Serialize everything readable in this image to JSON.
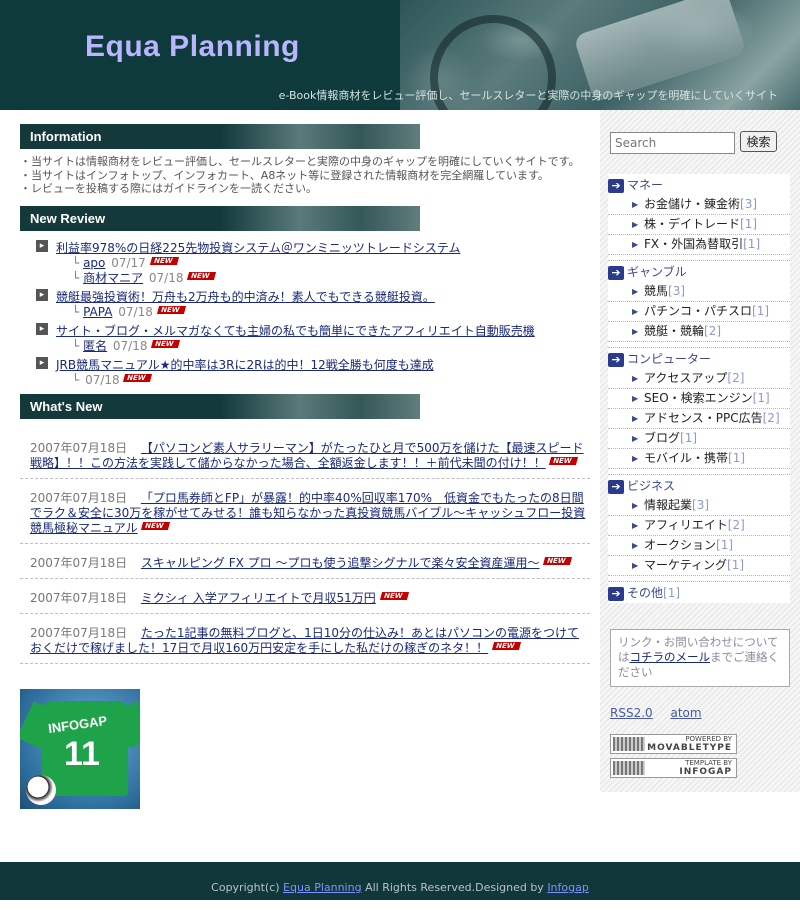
{
  "header": {
    "title": "Equa Planning",
    "tagline": "e-Book情報商材をレビュー評価し、セールスレターと実際の中身のギャップを明確にしていくサイト"
  },
  "information": {
    "heading": "Information",
    "items": [
      "当サイトは情報商材をレビュー評価し、セールスレターと実際の中身のギャップを明確にしていくサイトです。",
      "当サイトはインフォトップ、インフォカート、A8ネット等に登録された情報商材を完全網羅しています。",
      "レビューを投稿する際にはガイドラインを一読ください。"
    ]
  },
  "new_review": {
    "heading": "New Review",
    "new_label": "NEW",
    "corner": "└",
    "items": [
      {
        "title": "利益率978%の日経225先物投資システム＠ワンミニッツトレードシステム",
        "replies": [
          {
            "author": "apo",
            "date": "07/17"
          },
          {
            "author": "商材マニア",
            "date": "07/18"
          }
        ]
      },
      {
        "title": "競艇最強投資術！万舟も2万舟も的中済み！素人でもできる競艇投資。",
        "replies": [
          {
            "author": "PAPA",
            "date": "07/18"
          }
        ]
      },
      {
        "title": "サイト・ブログ・メルマガなくても主婦の私でも簡単にできたアフィリエイト自動販売機",
        "replies": [
          {
            "author": "匿名",
            "date": "07/18"
          }
        ]
      },
      {
        "title": "JRB競馬マニュアル★的中率は3Rに2Rは的中！12戦全勝も何度も達成",
        "replies": [
          {
            "author": "",
            "date": "07/18"
          }
        ]
      }
    ]
  },
  "whats_new": {
    "heading": "What's New",
    "items": [
      {
        "date": "2007年07月18日",
        "title": "【パソコンど素人サラリーマン】がたったひと月で500万を儲けた【最速スピード戦略】！！この方法を実践して儲からなかった場合、全額返金します！！＋前代未聞の付け！！"
      },
      {
        "date": "2007年07月18日",
        "title": "「プロ馬券師とFP」が暴露！的中率40%回収率170%　低資金でもたったの8日間でラク＆安全に30万を稼がせてみせる！誰も知らなかった真投資競馬バイブル〜キャッシュフロー投資競馬極秘マニュアル"
      },
      {
        "date": "2007年07月18日",
        "title": "スキャルピング FX プロ 〜プロも使う追撃シグナルで楽々安全資産運用〜"
      },
      {
        "date": "2007年07月18日",
        "title": "ミクシィ 入学アフィリエイトで月収51万円"
      },
      {
        "date": "2007年07月18日",
        "title": "たった1記事の無料ブログと、1日10分の仕込み！あとはパソコンの電源をつけておくだけで稼げました！17日で月収160万円安定を手にした私だけの稼ぎのネタ！！"
      }
    ]
  },
  "banner": {
    "text": "INFOGAP",
    "number": "11"
  },
  "sidebar": {
    "search_placeholder": "Search",
    "search_button": "検索",
    "categories": [
      {
        "label": "マネー",
        "subs": [
          {
            "label": "お金儲け・錬金術",
            "count": "[3]"
          },
          {
            "label": "株・デイトレード",
            "count": "[1]"
          },
          {
            "label": "FX・外国為替取引",
            "count": "[1]"
          }
        ]
      },
      {
        "label": "ギャンブル",
        "subs": [
          {
            "label": "競馬",
            "count": "[3]"
          },
          {
            "label": "パチンコ・パチスロ",
            "count": "[1]"
          },
          {
            "label": "競艇・競輪",
            "count": "[2]"
          }
        ]
      },
      {
        "label": "コンピューター",
        "subs": [
          {
            "label": "アクセスアップ",
            "count": "[2]"
          },
          {
            "label": "SEO・検索エンジン",
            "count": "[1]"
          },
          {
            "label": "アドセンス・PPC広告",
            "count": "[2]"
          },
          {
            "label": "ブログ",
            "count": "[1]"
          },
          {
            "label": "モバイル・携帯",
            "count": "[1]"
          }
        ]
      },
      {
        "label": "ビジネス",
        "subs": [
          {
            "label": "情報起業",
            "count": "[3]"
          },
          {
            "label": "アフィリエイト",
            "count": "[2]"
          },
          {
            "label": "オークション",
            "count": "[1]"
          },
          {
            "label": "マーケティング",
            "count": "[1]"
          }
        ]
      },
      {
        "label": "その他",
        "count": "[1]",
        "subs": []
      }
    ],
    "contact": {
      "before": "リンク・お問い合わせについては",
      "link": "コチラのメール",
      "after": "までご連絡ください"
    },
    "feeds": {
      "rss": "RSS2.0",
      "atom": "atom"
    },
    "powered_by": {
      "top": "POWERED BY",
      "name": "MOVABLETYPE"
    },
    "template_by": {
      "top": "TEMPLATE BY",
      "name": "INFOGAP"
    }
  },
  "footer": {
    "prefix": "Copyright(c) ",
    "site_link": "Equa Planning",
    "middle": " All Rights Reserved.Designed by ",
    "designer_link": "Infogap"
  }
}
